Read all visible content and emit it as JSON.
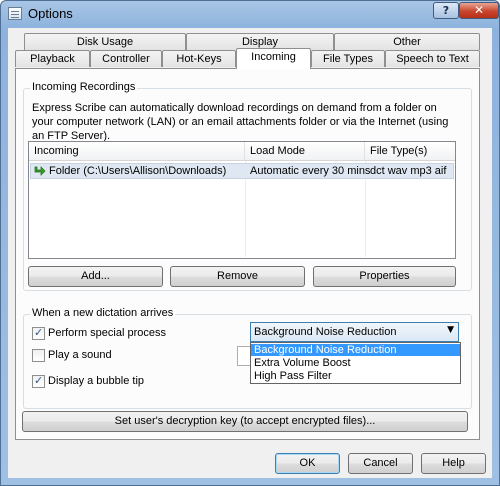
{
  "window": {
    "title": "Options",
    "help_glyph": "?",
    "close_glyph": "✕"
  },
  "tabs": {
    "row_top": [
      {
        "label": "Disk Usage"
      },
      {
        "label": "Display"
      },
      {
        "label": "Other"
      }
    ],
    "row_bottom": [
      {
        "label": "Playback"
      },
      {
        "label": "Controller"
      },
      {
        "label": "Hot-Keys"
      },
      {
        "label": "Incoming",
        "active": true
      },
      {
        "label": "File Types"
      },
      {
        "label": "Speech to Text"
      }
    ]
  },
  "incoming_group": {
    "label": "Incoming Recordings",
    "description": "Express Scribe can automatically download recordings on demand from a folder on your computer network (LAN) or an email attachments folder or via the Internet (using an FTP Server).",
    "columns": [
      "Incoming",
      "Load Mode",
      "File Type(s)"
    ],
    "rows": [
      {
        "incoming": "Folder (C:\\Users\\Allison\\Downloads)",
        "load_mode": "Automatic every 30 mins",
        "file_types": "dct wav mp3 aif",
        "icon": "green-arrow-icon"
      }
    ],
    "buttons": {
      "add": "Add...",
      "remove": "Remove",
      "properties": "Properties"
    }
  },
  "dictation_group": {
    "label": "When a new dictation arrives",
    "perform_special_process": {
      "label": "Perform special process",
      "checked": true
    },
    "play_sound": {
      "label": "Play a sound",
      "checked": false
    },
    "bubble_tip": {
      "label": "Display a bubble tip",
      "checked": true
    },
    "process_select": {
      "value": "Background Noise Reduction",
      "options": [
        "Background Noise Reduction",
        "Extra Volume Boost",
        "High Pass Filter"
      ],
      "highlighted_index": 0
    }
  },
  "decryption_button": "Set user's decryption key (to accept encrypted files)...",
  "footer": {
    "ok": "OK",
    "cancel": "Cancel",
    "help": "Help"
  },
  "colors": {
    "title_gradient": "#8db2dc",
    "selection": "#3399ff",
    "close_button": "#c9452c"
  }
}
